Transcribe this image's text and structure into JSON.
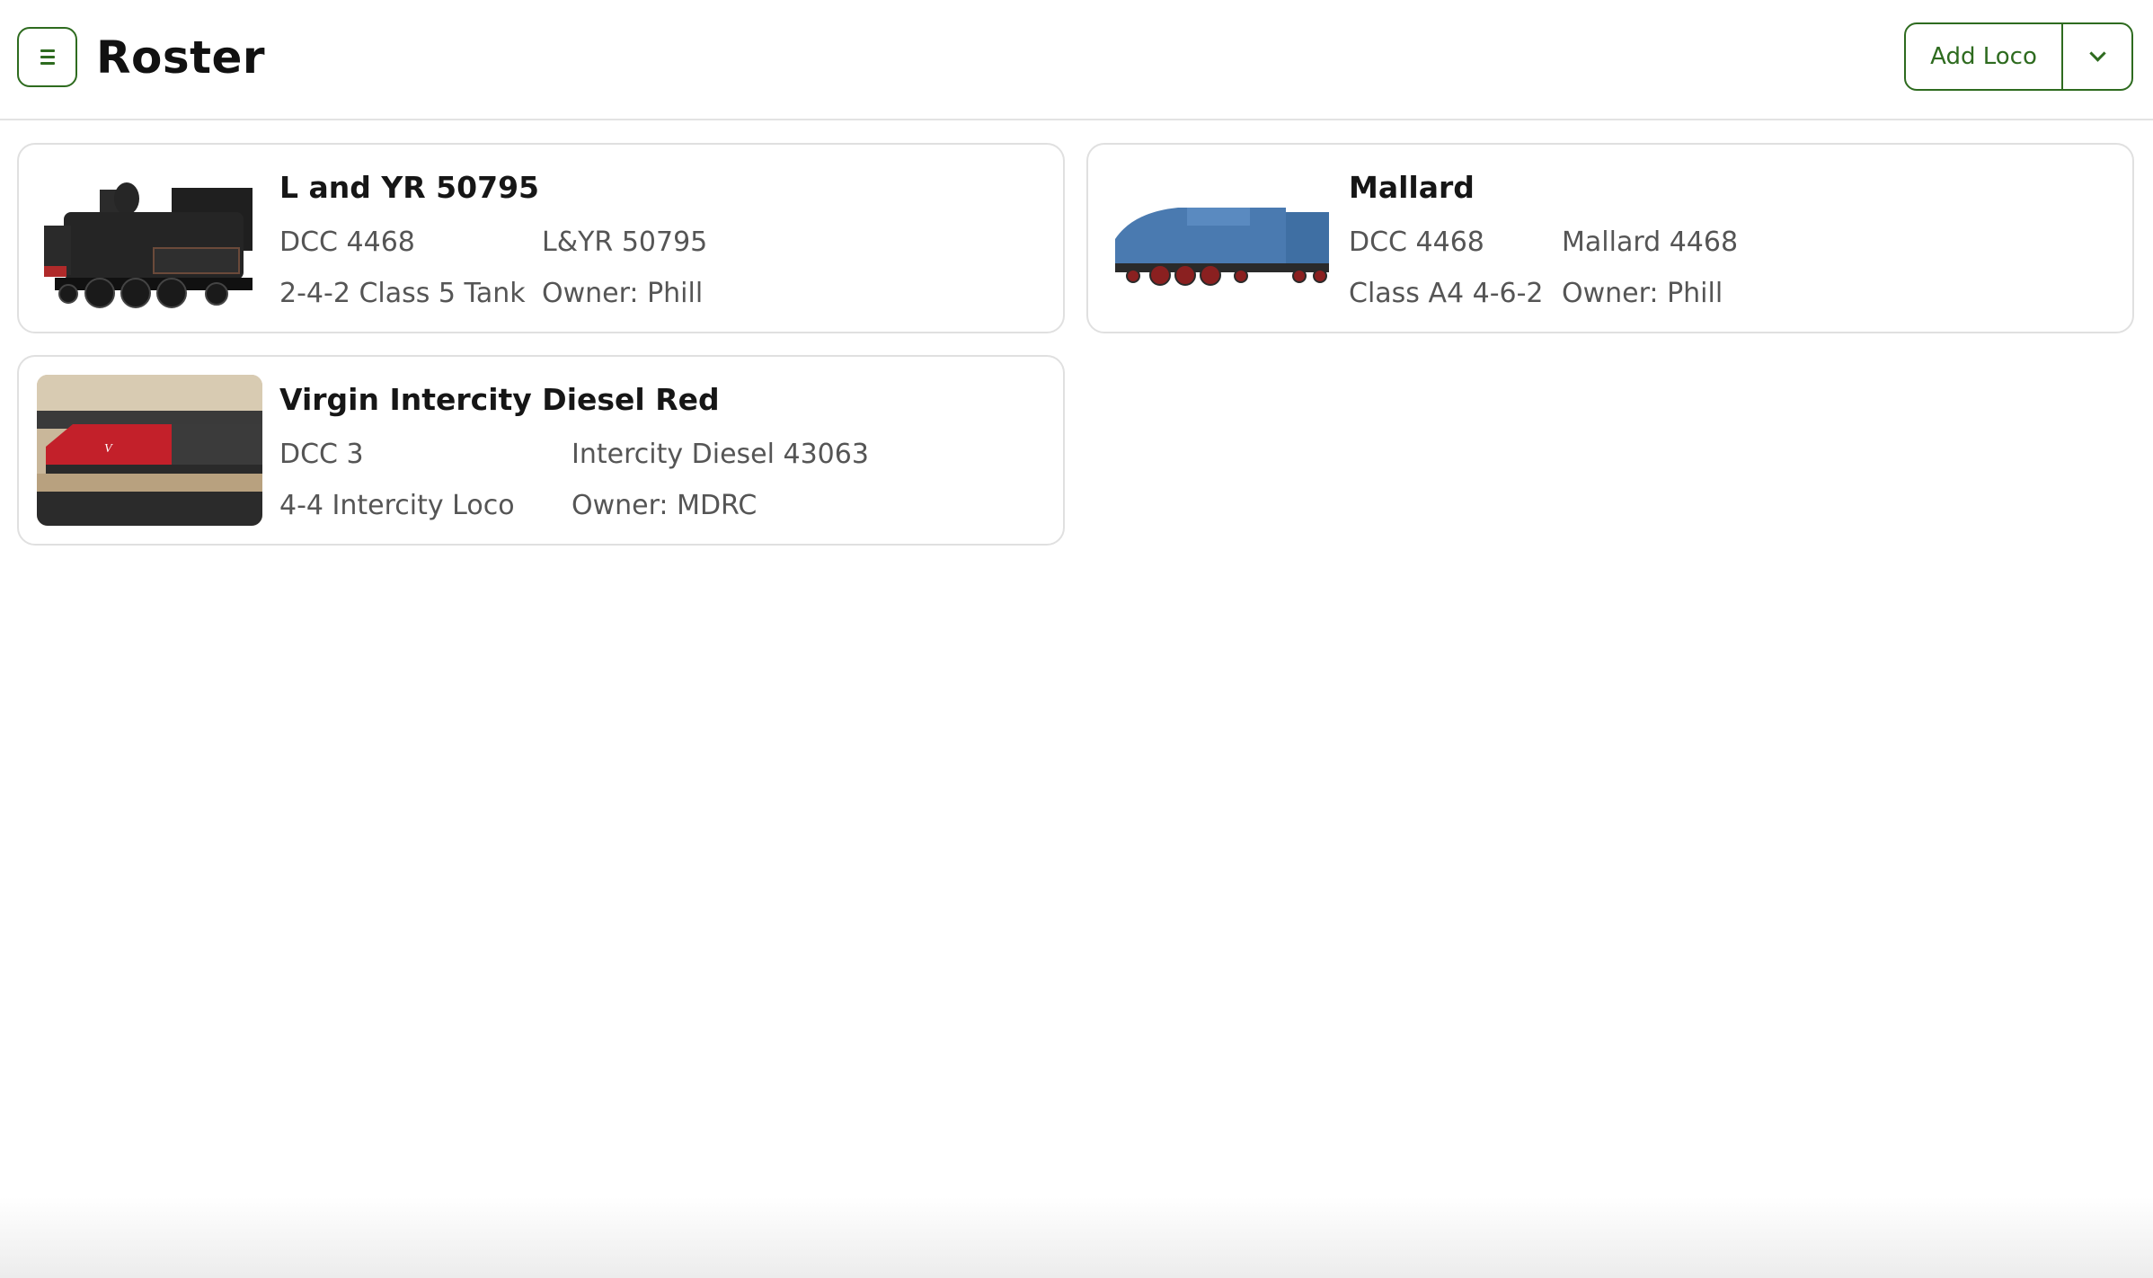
{
  "header": {
    "title": "Roster",
    "add_label": "Add Loco"
  },
  "locos": [
    {
      "name": "L and YR 50795",
      "dcc": "DCC 4468",
      "number": "L&YR 50795",
      "loco_class": "2-4-2 Class 5 Tank",
      "owner": "Owner: Phill"
    },
    {
      "name": "Mallard",
      "dcc": "DCC 4468",
      "number": "Mallard 4468",
      "loco_class": "Class A4 4-6-2",
      "owner": "Owner: Phill"
    },
    {
      "name": "Virgin Intercity Diesel Red",
      "dcc": "DCC 3",
      "number": "Intercity Diesel 43063",
      "loco_class": "4-4 Intercity Loco",
      "owner": "Owner: MDRC"
    }
  ],
  "colors": {
    "accent": "#2e6b1f",
    "card_border": "#e0e0e0",
    "muted_text": "#555555"
  },
  "icons": {
    "menu": "hamburger-icon",
    "dropdown": "chevron-down-icon"
  }
}
